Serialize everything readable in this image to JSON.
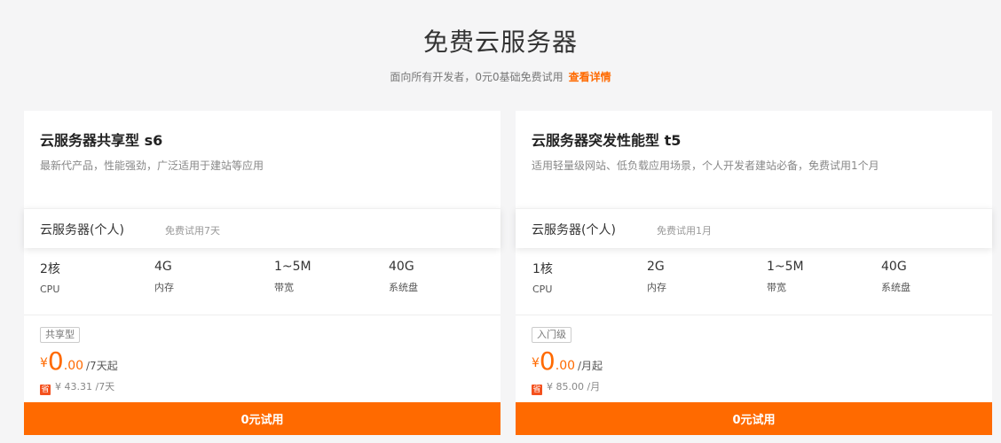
{
  "header": {
    "title": "免费云服务器",
    "subtitle": "面向所有开发者，0元0基础免费试用",
    "details_link": "查看详情"
  },
  "colors": {
    "accent": "#ff6a00",
    "background": "#f5f5f6"
  },
  "cards": [
    {
      "title": "云服务器共享型 s6",
      "desc": "最新代产品，性能强劲，广泛适用于建站等应用",
      "plan_name": "云服务器(个人)",
      "plan_trial": "免费试用7天",
      "specs": [
        {
          "value": "2核",
          "label": "CPU"
        },
        {
          "value": "4G",
          "label": "内存"
        },
        {
          "value": "1~5M",
          "label": "带宽"
        },
        {
          "value": "40G",
          "label": "系统盘"
        }
      ],
      "tag": "共享型",
      "price": {
        "currency": "¥",
        "int": "0",
        "dec": ".00",
        "unit": "/7天起"
      },
      "orig_icon": "省",
      "orig_price": "¥ 43.31 /7天",
      "cta": "0元试用"
    },
    {
      "title": "云服务器突发性能型 t5",
      "desc": "适用轻量级网站、低负载应用场景，个人开发者建站必备，免费试用1个月",
      "plan_name": "云服务器(个人)",
      "plan_trial": "免费试用1月",
      "specs": [
        {
          "value": "1核",
          "label": "CPU"
        },
        {
          "value": "2G",
          "label": "内存"
        },
        {
          "value": "1~5M",
          "label": "带宽"
        },
        {
          "value": "40G",
          "label": "系统盘"
        }
      ],
      "tag": "入门级",
      "price": {
        "currency": "¥",
        "int": "0",
        "dec": ".00",
        "unit": "/月起"
      },
      "orig_icon": "省",
      "orig_price": "¥ 85.00 /月",
      "cta": "0元试用"
    }
  ]
}
